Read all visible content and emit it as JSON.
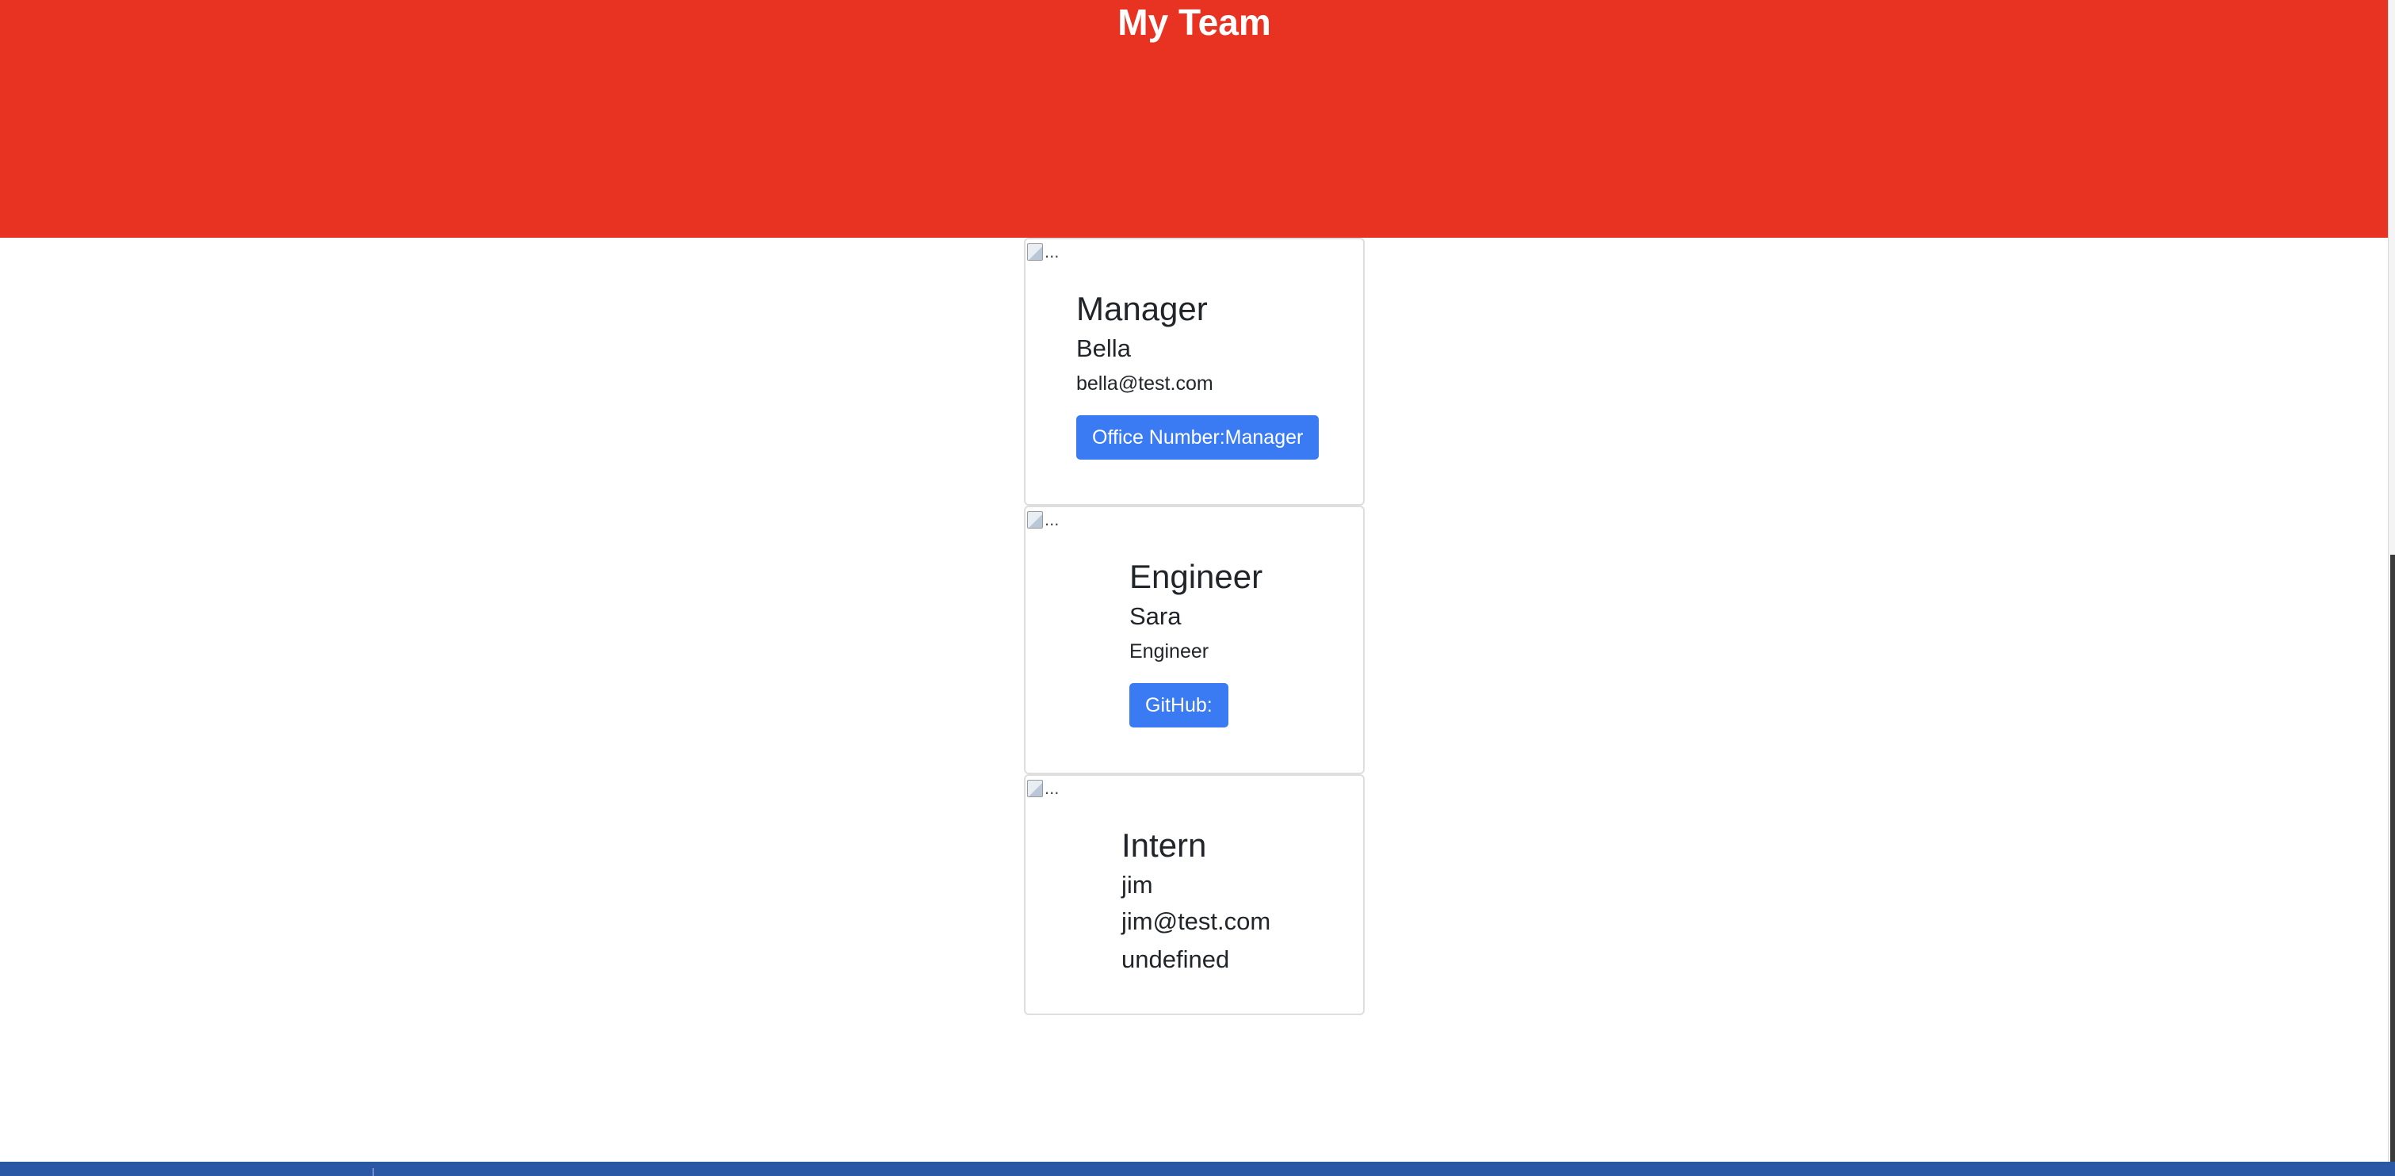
{
  "header": {
    "title": "My Team",
    "background_color": "#e83323"
  },
  "accent_color": "#3a7bf3",
  "cards": [
    {
      "image_alt": "...",
      "role": "Manager",
      "name": "Bella",
      "detail": "bella@test.com",
      "button_label": "Office Number:Manager"
    },
    {
      "image_alt": "...",
      "role": "Engineer",
      "name": "Sara",
      "detail": "Engineer",
      "button_label": "GitHub:"
    },
    {
      "image_alt": "...",
      "role": "Intern",
      "name": "jim",
      "detail": "jim@test.com",
      "extra": "undefined"
    }
  ]
}
